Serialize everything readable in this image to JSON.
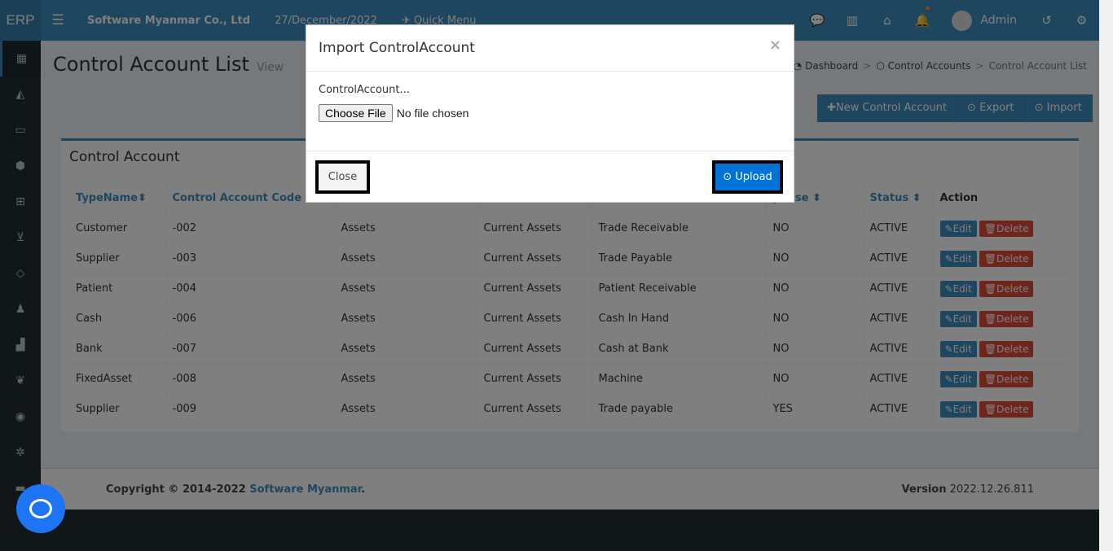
{
  "topbar": {
    "logo": "ERP",
    "company": "Software Myanmar Co., Ltd",
    "date": "27/December/2022",
    "quick_menu": "Quick Menu",
    "user": "Admin"
  },
  "page": {
    "title": "Control Account List",
    "subtitle": "View",
    "breadcrumb": [
      "Dashboard",
      "Control Accounts",
      "Control Account List"
    ]
  },
  "actions": {
    "new": "New Control Account",
    "export": "Export",
    "import": "Import"
  },
  "box": {
    "title": "Control Account",
    "headers": [
      "TypeName",
      "Control Account Code",
      "",
      "",
      "",
      "pense",
      "Status",
      "Action"
    ],
    "rows": [
      [
        "Customer",
        "-002",
        "Assets",
        "Current Assets",
        "Trade Receivable",
        "NO",
        "ACTIVE"
      ],
      [
        "Supplier",
        "-003",
        "Assets",
        "Current Assets",
        "Trade Payable",
        "NO",
        "ACTIVE"
      ],
      [
        "Patient",
        "-004",
        "Assets",
        "Current Assets",
        "Patient Receivable",
        "NO",
        "ACTIVE"
      ],
      [
        "Cash",
        "-006",
        "Assets",
        "Current Assets",
        "Cash In Hand",
        "NO",
        "ACTIVE"
      ],
      [
        "Bank",
        "-007",
        "Assets",
        "Current Assets",
        "Cash at Bank",
        "NO",
        "ACTIVE"
      ],
      [
        "FixedAsset",
        "-008",
        "Assets",
        "Current Assets",
        "Machine",
        "NO",
        "ACTIVE"
      ],
      [
        "Supplier",
        "-009",
        "Assets",
        "Current Assets",
        "Trade payable",
        "YES",
        "ACTIVE"
      ]
    ],
    "edit_label": "Edit",
    "delete_label": "Delete"
  },
  "footer": {
    "copyright": "Copyright © 2014-2022",
    "company_link": "Software Myanmar",
    "version_label": "Version",
    "version": "2022.12.26.811"
  },
  "modal": {
    "title": "Import ControlAccount",
    "close_x": "×",
    "label": "ControlAccount...",
    "file_button": "Choose File",
    "file_status": "No file chosen",
    "close_button": "Close",
    "upload_button": "Upload"
  }
}
